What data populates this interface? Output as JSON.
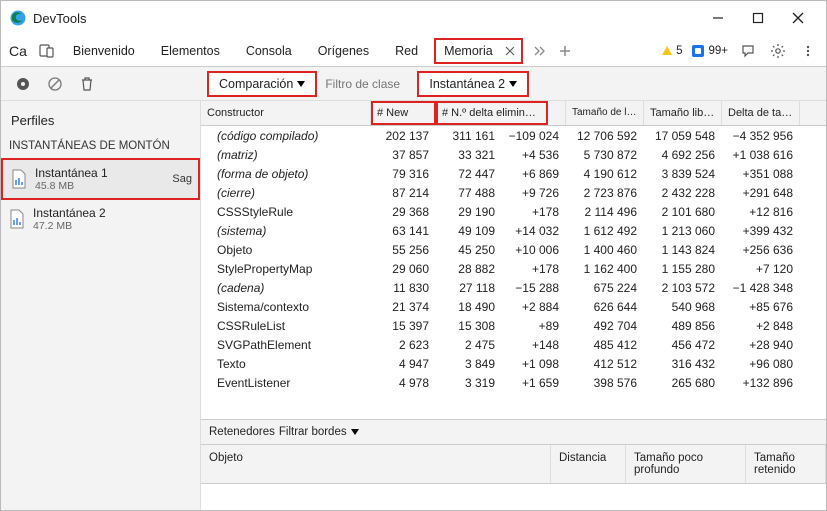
{
  "window": {
    "title": "DevTools"
  },
  "tabbar": {
    "leftGlyph": "Ca",
    "tabs": [
      "Bienvenido",
      "Elementos",
      "Consola",
      "Orígenes",
      "Red",
      "Memoria"
    ],
    "selected": "Memoria",
    "warnCount": "5",
    "infoCount": "99+"
  },
  "toolbar": {
    "comparison": "Comparación",
    "filterPlaceholder": "Filtro de clase",
    "snapshotSel": "Instantánea 2"
  },
  "sidebar": {
    "profilesLabel": "Perfiles",
    "heapHeader": "INSTANTÁNEAS DE MONTÓN",
    "snapshots": [
      {
        "name": "Instantánea 1",
        "size": "45.8 MB",
        "saveLabel": "Sag",
        "selected": true
      },
      {
        "name": "Instantánea 2",
        "size": "47.2 MB",
        "saveLabel": "",
        "selected": false
      }
    ]
  },
  "grid": {
    "headers": {
      "constructor": "Constructor",
      "new": "# New",
      "deleted": "# N.º delta eliminado",
      "delta": "",
      "allocSize": "Tamaño de la asignación",
      "freedSize": "Tamaño liberado",
      "sizeDelta": "Delta de tamaño a"
    },
    "rows": [
      {
        "c": "(código compilado)",
        "italic": true,
        "n": "202 137",
        "d": "311 161",
        "dl": "−109 024",
        "a": "12 706 592",
        "f": "17 059 548",
        "sd": "−4 352 956"
      },
      {
        "c": "(matriz)",
        "italic": true,
        "n": "37 857",
        "d": "33 321",
        "dl": "+4 536",
        "a": "5 730 872",
        "f": "4 692 256",
        "sd": "+1 038 616"
      },
      {
        "c": "(forma de objeto)",
        "italic": true,
        "n": "79 316",
        "d": "72 447",
        "dl": "+6 869",
        "a": "4 190 612",
        "f": "3 839 524",
        "sd": "+351 088"
      },
      {
        "c": "(cierre)",
        "italic": true,
        "n": "87 214",
        "d": "77 488",
        "dl": "+9 726",
        "a": "2 723 876",
        "f": "2 432 228",
        "sd": "+291 648"
      },
      {
        "c": "CSSStyleRule",
        "italic": false,
        "n": "29 368",
        "d": "29 190",
        "dl": "+178",
        "a": "2 114 496",
        "f": "2 101 680",
        "sd": "+12 816"
      },
      {
        "c": "(sistema)",
        "italic": true,
        "n": "63 141",
        "d": "49 109",
        "dl": "+14 032",
        "a": "1 612 492",
        "f": "1 213 060",
        "sd": "+399 432"
      },
      {
        "c": "Objeto",
        "italic": false,
        "n": "55 256",
        "d": "45 250",
        "dl": "+10 006",
        "a": "1 400 460",
        "f": "1 143 824",
        "sd": "+256 636"
      },
      {
        "c": "StylePropertyMap",
        "italic": false,
        "n": "29 060",
        "d": "28 882",
        "dl": "+178",
        "a": "1 162 400",
        "f": "1 155 280",
        "sd": "+7 120"
      },
      {
        "c": "(cadena)",
        "italic": true,
        "n": "11 830",
        "d": "27 118",
        "dl": "−15 288",
        "a": "675 224",
        "f": "2 103 572",
        "sd": "−1 428 348"
      },
      {
        "c": "Sistema/contexto",
        "italic": false,
        "n": "21 374",
        "d": "18 490",
        "dl": "+2 884",
        "a": "626 644",
        "f": "540 968",
        "sd": "+85 676"
      },
      {
        "c": "CSSRuleList",
        "italic": false,
        "n": "15 397",
        "d": "15 308",
        "dl": "+89",
        "a": "492 704",
        "f": "489 856",
        "sd": "+2 848"
      },
      {
        "c": "SVGPathElement",
        "italic": false,
        "n": "2 623",
        "d": "2 475",
        "dl": "+148",
        "a": "485 412",
        "f": "456 472",
        "sd": "+28 940"
      },
      {
        "c": "Texto",
        "italic": false,
        "n": "4 947",
        "d": "3 849",
        "dl": "+1 098",
        "a": "412 512",
        "f": "316 432",
        "sd": "+96 080"
      },
      {
        "c": "EventListener",
        "italic": false,
        "n": "4 978",
        "d": "3 319",
        "dl": "+1 659",
        "a": "398 576",
        "f": "265 680",
        "sd": "+132 896"
      }
    ]
  },
  "retainers": {
    "label": "Retenedores",
    "filter": "Filtrar bordes"
  },
  "bottomGrid": {
    "headers": {
      "object": "Objeto",
      "distance": "Distancia",
      "shallow": "Tamaño poco profundo",
      "retained": "Tamaño retenido"
    }
  }
}
